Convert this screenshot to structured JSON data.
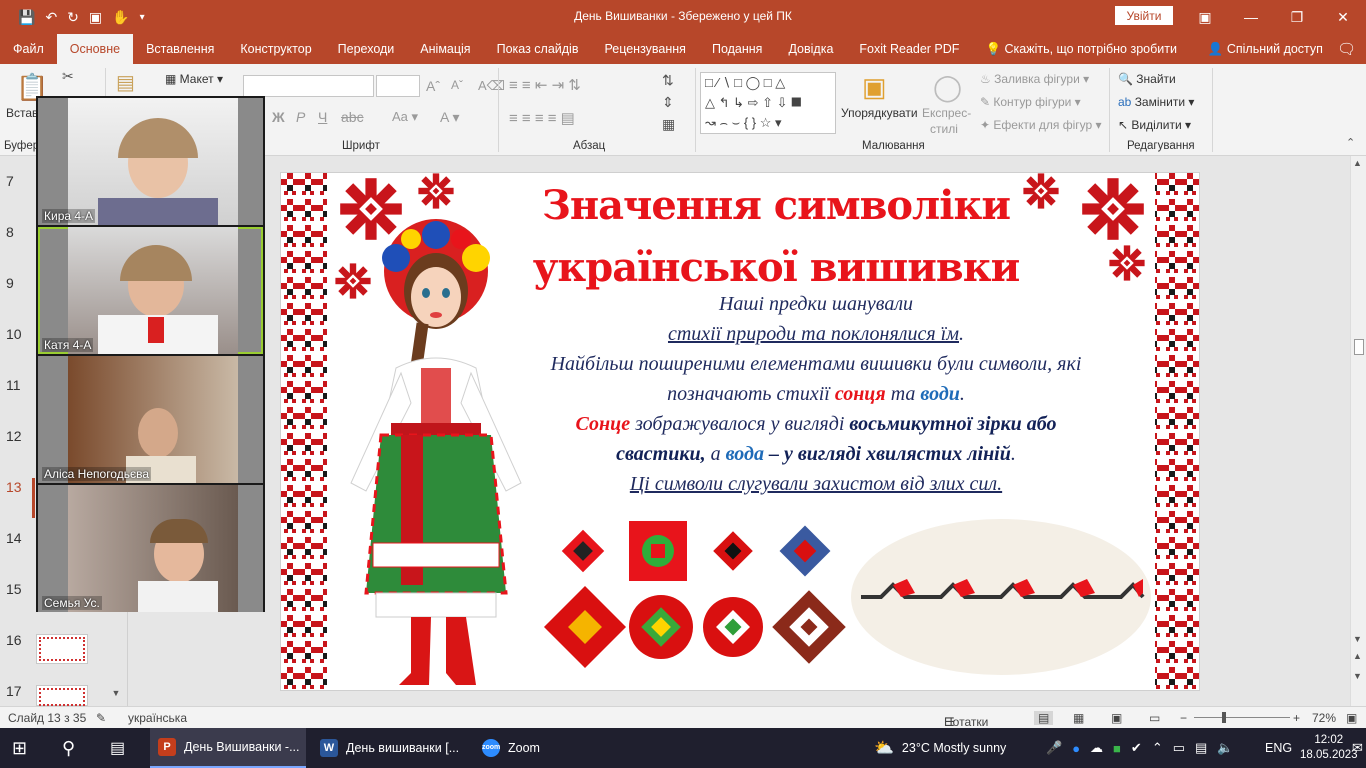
{
  "window": {
    "title": "День Вишиванки  -  Збережено у цей ПК",
    "signin_label": "Увійти",
    "accent": "#b7472a"
  },
  "ribbon": {
    "tabs": [
      "Файл",
      "Основне",
      "Вставлення",
      "Конструктор",
      "Переходи",
      "Анімація",
      "Показ слайдів",
      "Рецензування",
      "Подання",
      "Довідка",
      "Foxit Reader PDF"
    ],
    "active_tab": "Основне",
    "tell_me": "Скажіть, що потрібно зробити",
    "share": "Спільний доступ",
    "groups": {
      "clipboard": "Буфер",
      "font": "Шрифт",
      "paragraph": "Абзац",
      "drawing": "Малювання",
      "editing": "Редагування"
    },
    "paste_label": "Встав",
    "layout_label": "Макет",
    "arrange_label": "Упорядкувати",
    "quick_styles_label_1": "Експрес-",
    "quick_styles_label_2": "стилі",
    "shape_fill": "Заливка фігури",
    "shape_outline": "Контур фігури",
    "shape_effects": "Ефекти для фігур",
    "find": "Знайти",
    "replace": "Замінити",
    "select": "Виділити"
  },
  "slides_pane": {
    "numbers": [
      "7",
      "8",
      "9",
      "10",
      "11",
      "12",
      "13",
      "14",
      "15",
      "16",
      "17"
    ],
    "current": "13"
  },
  "zoom_participants": [
    {
      "name": "Кира 4-А"
    },
    {
      "name": "Катя  4-А"
    },
    {
      "name": "Аліса Непогодьєва"
    },
    {
      "name": "Семья Ус."
    }
  ],
  "slide": {
    "title_line1": "Значення символіки",
    "title_line2": "української вишивки",
    "line1": "Наші предки шанували",
    "line2": "стихії природи та поклонялися їм",
    "line2_end": ".",
    "line3": "Найбільш поширеними елементами вишивки були символи, які",
    "line4_a": "позначають стихії ",
    "line4_sun": "сонця",
    "line4_b": " та ",
    "line4_water": "води",
    "line4_end": ".",
    "line5_sun": "Сонце",
    "line5_a": " зображувалося у вигляді ",
    "line5_b": "восьмикутної зірки або",
    "line6_a": "свастики,",
    "line6_b": " а ",
    "line6_water": "вода",
    "line6_c": " – у вигляді хвилястих ліній",
    "line6_end": ".",
    "line7": "Ці символи слугували захистом від злих сил."
  },
  "statusbar": {
    "slide_info": "Слайд 13 з 35",
    "language": "українська",
    "notes": "Нотатки",
    "zoom": "72%"
  },
  "taskbar": {
    "apps": [
      "День Вишиванки -...",
      "День вишиванки [...",
      "Zoom"
    ],
    "weather": "23°C  Mostly sunny",
    "lang": "ENG",
    "time": "12:02",
    "date": "18.05.2023"
  }
}
